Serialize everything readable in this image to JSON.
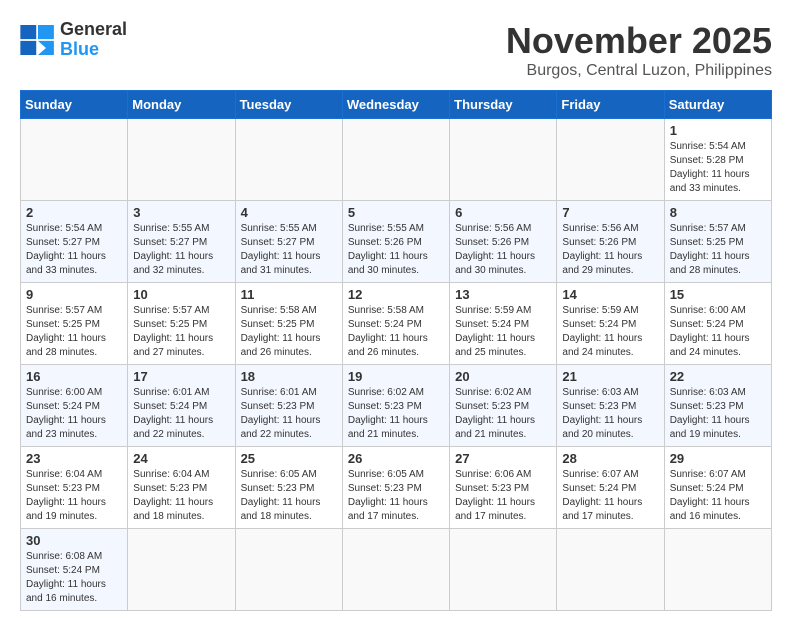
{
  "header": {
    "logo_general": "General",
    "logo_blue": "Blue",
    "month": "November 2025",
    "location": "Burgos, Central Luzon, Philippines"
  },
  "weekdays": [
    "Sunday",
    "Monday",
    "Tuesday",
    "Wednesday",
    "Thursday",
    "Friday",
    "Saturday"
  ],
  "weeks": [
    [
      {
        "day": "",
        "info": ""
      },
      {
        "day": "",
        "info": ""
      },
      {
        "day": "",
        "info": ""
      },
      {
        "day": "",
        "info": ""
      },
      {
        "day": "",
        "info": ""
      },
      {
        "day": "",
        "info": ""
      },
      {
        "day": "1",
        "info": "Sunrise: 5:54 AM\nSunset: 5:28 PM\nDaylight: 11 hours\nand 33 minutes."
      }
    ],
    [
      {
        "day": "2",
        "info": "Sunrise: 5:54 AM\nSunset: 5:27 PM\nDaylight: 11 hours\nand 33 minutes."
      },
      {
        "day": "3",
        "info": "Sunrise: 5:55 AM\nSunset: 5:27 PM\nDaylight: 11 hours\nand 32 minutes."
      },
      {
        "day": "4",
        "info": "Sunrise: 5:55 AM\nSunset: 5:27 PM\nDaylight: 11 hours\nand 31 minutes."
      },
      {
        "day": "5",
        "info": "Sunrise: 5:55 AM\nSunset: 5:26 PM\nDaylight: 11 hours\nand 30 minutes."
      },
      {
        "day": "6",
        "info": "Sunrise: 5:56 AM\nSunset: 5:26 PM\nDaylight: 11 hours\nand 30 minutes."
      },
      {
        "day": "7",
        "info": "Sunrise: 5:56 AM\nSunset: 5:26 PM\nDaylight: 11 hours\nand 29 minutes."
      },
      {
        "day": "8",
        "info": "Sunrise: 5:57 AM\nSunset: 5:25 PM\nDaylight: 11 hours\nand 28 minutes."
      }
    ],
    [
      {
        "day": "9",
        "info": "Sunrise: 5:57 AM\nSunset: 5:25 PM\nDaylight: 11 hours\nand 28 minutes."
      },
      {
        "day": "10",
        "info": "Sunrise: 5:57 AM\nSunset: 5:25 PM\nDaylight: 11 hours\nand 27 minutes."
      },
      {
        "day": "11",
        "info": "Sunrise: 5:58 AM\nSunset: 5:25 PM\nDaylight: 11 hours\nand 26 minutes."
      },
      {
        "day": "12",
        "info": "Sunrise: 5:58 AM\nSunset: 5:24 PM\nDaylight: 11 hours\nand 26 minutes."
      },
      {
        "day": "13",
        "info": "Sunrise: 5:59 AM\nSunset: 5:24 PM\nDaylight: 11 hours\nand 25 minutes."
      },
      {
        "day": "14",
        "info": "Sunrise: 5:59 AM\nSunset: 5:24 PM\nDaylight: 11 hours\nand 24 minutes."
      },
      {
        "day": "15",
        "info": "Sunrise: 6:00 AM\nSunset: 5:24 PM\nDaylight: 11 hours\nand 24 minutes."
      }
    ],
    [
      {
        "day": "16",
        "info": "Sunrise: 6:00 AM\nSunset: 5:24 PM\nDaylight: 11 hours\nand 23 minutes."
      },
      {
        "day": "17",
        "info": "Sunrise: 6:01 AM\nSunset: 5:24 PM\nDaylight: 11 hours\nand 22 minutes."
      },
      {
        "day": "18",
        "info": "Sunrise: 6:01 AM\nSunset: 5:23 PM\nDaylight: 11 hours\nand 22 minutes."
      },
      {
        "day": "19",
        "info": "Sunrise: 6:02 AM\nSunset: 5:23 PM\nDaylight: 11 hours\nand 21 minutes."
      },
      {
        "day": "20",
        "info": "Sunrise: 6:02 AM\nSunset: 5:23 PM\nDaylight: 11 hours\nand 21 minutes."
      },
      {
        "day": "21",
        "info": "Sunrise: 6:03 AM\nSunset: 5:23 PM\nDaylight: 11 hours\nand 20 minutes."
      },
      {
        "day": "22",
        "info": "Sunrise: 6:03 AM\nSunset: 5:23 PM\nDaylight: 11 hours\nand 19 minutes."
      }
    ],
    [
      {
        "day": "23",
        "info": "Sunrise: 6:04 AM\nSunset: 5:23 PM\nDaylight: 11 hours\nand 19 minutes."
      },
      {
        "day": "24",
        "info": "Sunrise: 6:04 AM\nSunset: 5:23 PM\nDaylight: 11 hours\nand 18 minutes."
      },
      {
        "day": "25",
        "info": "Sunrise: 6:05 AM\nSunset: 5:23 PM\nDaylight: 11 hours\nand 18 minutes."
      },
      {
        "day": "26",
        "info": "Sunrise: 6:05 AM\nSunset: 5:23 PM\nDaylight: 11 hours\nand 17 minutes."
      },
      {
        "day": "27",
        "info": "Sunrise: 6:06 AM\nSunset: 5:23 PM\nDaylight: 11 hours\nand 17 minutes."
      },
      {
        "day": "28",
        "info": "Sunrise: 6:07 AM\nSunset: 5:24 PM\nDaylight: 11 hours\nand 17 minutes."
      },
      {
        "day": "29",
        "info": "Sunrise: 6:07 AM\nSunset: 5:24 PM\nDaylight: 11 hours\nand 16 minutes."
      }
    ],
    [
      {
        "day": "30",
        "info": "Sunrise: 6:08 AM\nSunset: 5:24 PM\nDaylight: 11 hours\nand 16 minutes."
      },
      {
        "day": "",
        "info": ""
      },
      {
        "day": "",
        "info": ""
      },
      {
        "day": "",
        "info": ""
      },
      {
        "day": "",
        "info": ""
      },
      {
        "day": "",
        "info": ""
      },
      {
        "day": "",
        "info": ""
      }
    ]
  ]
}
